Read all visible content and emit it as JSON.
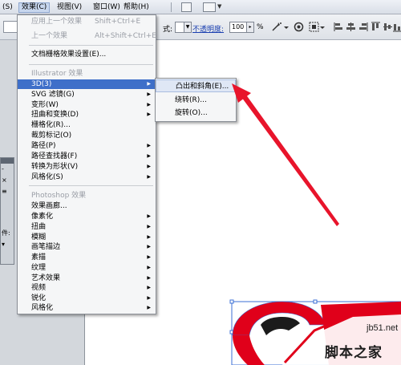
{
  "menubar": {
    "items": [
      {
        "label": "(S)"
      },
      {
        "label": "效果(C)"
      },
      {
        "label": "视图(V)"
      },
      {
        "label": "窗口(W)"
      },
      {
        "label": "帮助(H)"
      }
    ]
  },
  "control_bar": {
    "style_suffix": "式:",
    "opacity_label": "不透明度:",
    "opacity_value": "100",
    "percent": "%"
  },
  "effect_menu": {
    "apply_last": {
      "label": "应用上一个效果",
      "shortcut": "Shift+Ctrl+E"
    },
    "last_effect": {
      "label": "上一个效果",
      "shortcut": "Alt+Shift+Ctrl+E"
    },
    "doc_raster": "文档栅格效果设置(E)...",
    "illustrator_header": "Illustrator 效果",
    "illustrator_items": [
      {
        "label": "3D(3)"
      },
      {
        "label": "SVG 滤镜(G)"
      },
      {
        "label": "变形(W)"
      },
      {
        "label": "扭曲和变换(D)"
      },
      {
        "label": "栅格化(R)..."
      },
      {
        "label": "裁剪标记(O)"
      },
      {
        "label": "路径(P)"
      },
      {
        "label": "路径查找器(F)"
      },
      {
        "label": "转换为形状(V)"
      },
      {
        "label": "风格化(S)"
      }
    ],
    "photoshop_header": "Photoshop 效果",
    "photoshop_items": [
      {
        "label": "效果画廊..."
      },
      {
        "label": "像素化"
      },
      {
        "label": "扭曲"
      },
      {
        "label": "模糊"
      },
      {
        "label": "画笔描边"
      },
      {
        "label": "素描"
      },
      {
        "label": "纹理"
      },
      {
        "label": "艺术效果"
      },
      {
        "label": "视频"
      },
      {
        "label": "锐化"
      },
      {
        "label": "风格化"
      }
    ]
  },
  "submenu_3d": {
    "items": [
      {
        "label": "凸出和斜角(E)..."
      },
      {
        "label": "绕转(R)..."
      },
      {
        "label": "旋转(O)..."
      }
    ]
  },
  "left_panel": {
    "rows": [
      "-",
      "×",
      "≡",
      "件:",
      "▾"
    ]
  },
  "watermark": {
    "url": "jb51.net",
    "name": "脚本之家"
  },
  "colors": {
    "highlight": "#3e6fc9",
    "arrow": "#e8142b",
    "shape": "#e0001a"
  }
}
